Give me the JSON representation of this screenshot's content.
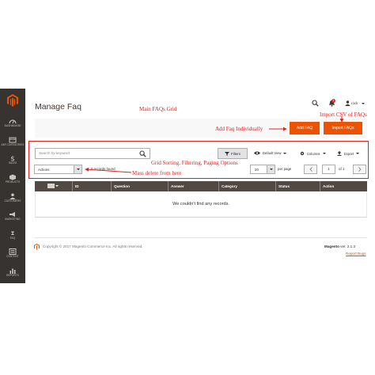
{
  "page": {
    "title": "Manage Faq"
  },
  "header": {
    "user_name": "rock",
    "notification_count": "1"
  },
  "sidebar": {
    "items": [
      {
        "label": "DASHBOARD",
        "icon": "dashboard-icon"
      },
      {
        "label": "AMT CATEGORIES",
        "icon": "categories-icon"
      },
      {
        "label": "SALES",
        "icon": "dollar-icon"
      },
      {
        "label": "PRODUCTS",
        "icon": "cube-icon"
      },
      {
        "label": "CUSTOMERS",
        "icon": "person-icon"
      },
      {
        "label": "MARKETING",
        "icon": "megaphone-icon"
      },
      {
        "label": "FAQ",
        "icon": "question-icon"
      },
      {
        "label": "CONTENT",
        "icon": "content-icon"
      },
      {
        "label": "REPORTS",
        "icon": "bar-chart-icon"
      }
    ]
  },
  "buttons": {
    "add_faq": "Add FAQ",
    "import_faqs": "Import FAQs"
  },
  "toolbar": {
    "search_placeholder": "Search by keyword",
    "filters": "Filters",
    "default_view": "Default View",
    "columns": "Columns",
    "export": "Export"
  },
  "mass_actions": {
    "selected": "Actions",
    "records_found": "0 records found"
  },
  "pagination": {
    "per_page_value": "20",
    "per_page_label": "per page",
    "current_page": "1",
    "of_label": "of 1"
  },
  "table": {
    "columns": [
      "ID",
      "Question",
      "Answer",
      "Category",
      "Status",
      "Action"
    ],
    "empty_message": "We couldn't find any records."
  },
  "footer": {
    "copyright": "Copyright © 2017 Magento Commerce Inc. All rights reserved.",
    "brand": "Magento",
    "version": "ver. 2.1.3",
    "report_bugs": "Report Bugs"
  },
  "annotations": {
    "main_grid": "Main FAQs Grid",
    "add_faq": "Add Faq Individually",
    "import_csv": "Import CSV of FAQs",
    "grid_options": "Grid Sorting, Filtering, Paging Options",
    "mass_delete": "Mass delete from here"
  },
  "colors": {
    "accent": "#eb5202",
    "sidebar": "#373330",
    "table_header": "#514943",
    "annotation": "#e41f1f"
  }
}
